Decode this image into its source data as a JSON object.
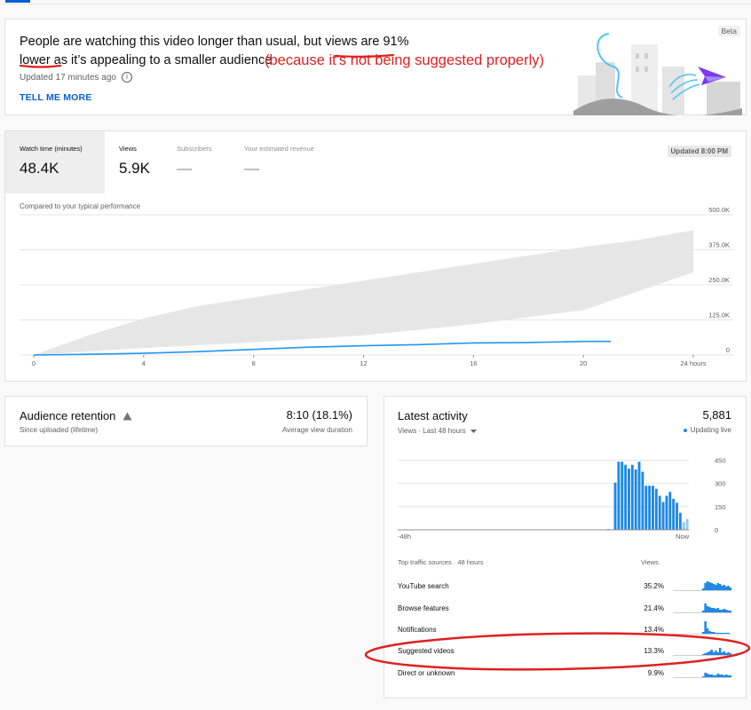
{
  "insight": {
    "text_part1": "People are watching this video longer than usual, but views ",
    "text_highlight1": "are 91%",
    "text_highlight2": "lower",
    "text_part2": " as it’s appealing to a smaller audience",
    "annotation": "(because it's not being suggested properly)",
    "updated": "Updated 17 minutes ago",
    "tell_me_more": "TELL ME MORE",
    "beta": "Beta",
    "info_icon": "info-icon"
  },
  "metrics": [
    {
      "label": "Watch time (minutes)",
      "value": "48.4K",
      "active": true
    },
    {
      "label": "Views",
      "value": "5.9K",
      "active": false
    },
    {
      "label": "Subscribers",
      "value": "—",
      "active": false
    },
    {
      "label": "Your estimated revenue",
      "value": "—",
      "active": false
    }
  ],
  "updated_badge": "Updated 8:00 PM",
  "compare_label": "Compared to your typical performance",
  "chart_data": {
    "type": "area",
    "x": [
      0,
      4,
      8,
      12,
      16,
      20,
      24
    ],
    "x_tick_labels": [
      "0",
      "4",
      "8",
      "12",
      "16",
      "20",
      "24 hours"
    ],
    "y_tick_labels": [
      "0",
      "125.0K",
      "250.0K",
      "375.0K",
      "500.0K"
    ],
    "ylim": [
      0,
      500000
    ],
    "xlim": [
      0,
      24
    ],
    "band_upper": [
      [
        0,
        0
      ],
      [
        2,
        70000
      ],
      [
        4,
        130000
      ],
      [
        6,
        175000
      ],
      [
        8,
        205000
      ],
      [
        10,
        235000
      ],
      [
        12,
        265000
      ],
      [
        14,
        295000
      ],
      [
        16,
        325000
      ],
      [
        18,
        355000
      ],
      [
        20,
        385000
      ],
      [
        22,
        410000
      ],
      [
        24,
        445000
      ]
    ],
    "band_lower": [
      [
        0,
        0
      ],
      [
        4,
        25000
      ],
      [
        8,
        45000
      ],
      [
        12,
        70000
      ],
      [
        16,
        110000
      ],
      [
        20,
        160000
      ],
      [
        24,
        295000
      ]
    ],
    "series": [
      {
        "values": [
          [
            0,
            0
          ],
          [
            2,
            2500
          ],
          [
            4,
            6000
          ],
          [
            6,
            12000
          ],
          [
            8,
            20000
          ],
          [
            10,
            28000
          ],
          [
            12,
            33000
          ],
          [
            14,
            37000
          ],
          [
            16,
            43000
          ],
          [
            18,
            44500
          ],
          [
            20,
            48400
          ],
          [
            21,
            48400
          ]
        ]
      }
    ],
    "colors": {
      "line": "#2196f3",
      "band": "#e6e6e6",
      "grid": "#e5e5e5"
    }
  },
  "retention": {
    "title": "Audience retention",
    "warning_icon": "warning-triangle-icon",
    "subtitle": "Since uploaded (lifetime)",
    "value": "8:10 (18.1%)",
    "value_label": "Average view duration"
  },
  "activity": {
    "title": "Latest activity",
    "count": "5,881",
    "selector": "Views · Last 48 hours",
    "live": "Updating live",
    "bar_chart": {
      "values": [
        0,
        0,
        0,
        0,
        0,
        0,
        0,
        0,
        0,
        0,
        0,
        0,
        0,
        0,
        0,
        0,
        0,
        0,
        0,
        0,
        0,
        0,
        0,
        0,
        0,
        0,
        0,
        0,
        0,
        0,
        0,
        0,
        0,
        0,
        0,
        0,
        0,
        0,
        0,
        0,
        0,
        0,
        0,
        0,
        0,
        0,
        0,
        0,
        0,
        0,
        0,
        0,
        0,
        0,
        0,
        0,
        0,
        0,
        0,
        0,
        0,
        5,
        0,
        305,
        440,
        440,
        420,
        395,
        420,
        390,
        440,
        375,
        285,
        285,
        285,
        265,
        220,
        180,
        220,
        245,
        200,
        175,
        110,
        50,
        70
      ],
      "last_highlight_indices": [
        83,
        84
      ],
      "y_tick_labels": [
        "0",
        "150",
        "300",
        "450"
      ],
      "ylim": [
        0,
        520
      ],
      "x_labels": [
        "-48h",
        "Now"
      ]
    },
    "traffic_header": "Top traffic sources · 48 hours",
    "traffic_col": "Views",
    "traffic_sources": [
      {
        "name": "YouTube search",
        "pct": "35.2%",
        "spark": [
          0,
          0,
          0,
          0,
          0,
          0,
          0,
          0,
          0,
          0,
          0,
          0,
          0,
          0,
          2,
          8,
          10,
          9,
          8,
          7,
          6,
          8,
          7,
          5,
          6,
          4,
          5,
          3
        ]
      },
      {
        "name": "Browse features",
        "pct": "21.4%",
        "spark": [
          0,
          0,
          0,
          0,
          0,
          0,
          0,
          0,
          0,
          0,
          0,
          0,
          0,
          0,
          2,
          10,
          7,
          6,
          5,
          5,
          4,
          5,
          3,
          3,
          4,
          3,
          2,
          2
        ]
      },
      {
        "name": "Notifications",
        "pct": "13.4%",
        "spark": [
          0,
          0,
          0,
          0,
          0,
          0,
          0,
          0,
          0,
          0,
          0,
          0,
          0,
          0,
          2,
          14,
          6,
          3,
          2,
          2,
          1,
          1,
          1,
          1,
          1,
          1,
          1,
          0
        ]
      },
      {
        "name": "Suggested videos",
        "pct": "13.3%",
        "spark": [
          0,
          0,
          0,
          0,
          0,
          0,
          0,
          0,
          0,
          0,
          0,
          0,
          0,
          0,
          1,
          2,
          3,
          4,
          6,
          3,
          5,
          3,
          8,
          3,
          4,
          2,
          3,
          2
        ]
      },
      {
        "name": "Direct or unknown",
        "pct": "9.9%",
        "spark": [
          0,
          0,
          0,
          0,
          0,
          0,
          0,
          0,
          0,
          0,
          0,
          0,
          0,
          0,
          1,
          5,
          4,
          3,
          3,
          2,
          2,
          4,
          3,
          3,
          2,
          3,
          2,
          2
        ]
      }
    ]
  },
  "colors": {
    "annotation_red": "#e02020",
    "link_blue": "#065fd4",
    "bar_blue": "#1e88e5",
    "bar_light": "#90caf9"
  }
}
